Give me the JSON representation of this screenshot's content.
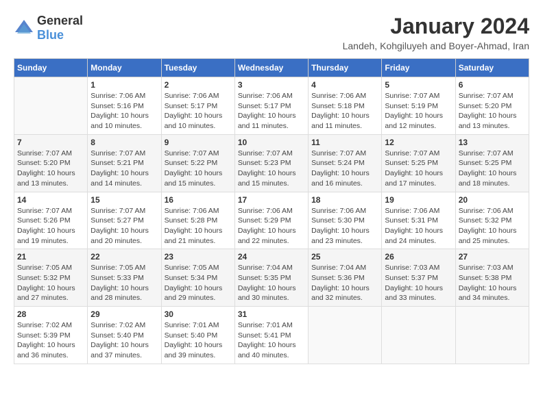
{
  "logo": {
    "text_general": "General",
    "text_blue": "Blue"
  },
  "header": {
    "month_year": "January 2024",
    "location": "Landeh, Kohgiluyeh and Boyer-Ahmad, Iran"
  },
  "weekdays": [
    "Sunday",
    "Monday",
    "Tuesday",
    "Wednesday",
    "Thursday",
    "Friday",
    "Saturday"
  ],
  "weeks": [
    [
      {
        "day": "",
        "info": ""
      },
      {
        "day": "1",
        "info": "Sunrise: 7:06 AM\nSunset: 5:16 PM\nDaylight: 10 hours and 10 minutes."
      },
      {
        "day": "2",
        "info": "Sunrise: 7:06 AM\nSunset: 5:17 PM\nDaylight: 10 hours and 10 minutes."
      },
      {
        "day": "3",
        "info": "Sunrise: 7:06 AM\nSunset: 5:17 PM\nDaylight: 10 hours and 11 minutes."
      },
      {
        "day": "4",
        "info": "Sunrise: 7:06 AM\nSunset: 5:18 PM\nDaylight: 10 hours and 11 minutes."
      },
      {
        "day": "5",
        "info": "Sunrise: 7:07 AM\nSunset: 5:19 PM\nDaylight: 10 hours and 12 minutes."
      },
      {
        "day": "6",
        "info": "Sunrise: 7:07 AM\nSunset: 5:20 PM\nDaylight: 10 hours and 13 minutes."
      }
    ],
    [
      {
        "day": "7",
        "info": "Sunrise: 7:07 AM\nSunset: 5:20 PM\nDaylight: 10 hours and 13 minutes."
      },
      {
        "day": "8",
        "info": "Sunrise: 7:07 AM\nSunset: 5:21 PM\nDaylight: 10 hours and 14 minutes."
      },
      {
        "day": "9",
        "info": "Sunrise: 7:07 AM\nSunset: 5:22 PM\nDaylight: 10 hours and 15 minutes."
      },
      {
        "day": "10",
        "info": "Sunrise: 7:07 AM\nSunset: 5:23 PM\nDaylight: 10 hours and 15 minutes."
      },
      {
        "day": "11",
        "info": "Sunrise: 7:07 AM\nSunset: 5:24 PM\nDaylight: 10 hours and 16 minutes."
      },
      {
        "day": "12",
        "info": "Sunrise: 7:07 AM\nSunset: 5:25 PM\nDaylight: 10 hours and 17 minutes."
      },
      {
        "day": "13",
        "info": "Sunrise: 7:07 AM\nSunset: 5:25 PM\nDaylight: 10 hours and 18 minutes."
      }
    ],
    [
      {
        "day": "14",
        "info": "Sunrise: 7:07 AM\nSunset: 5:26 PM\nDaylight: 10 hours and 19 minutes."
      },
      {
        "day": "15",
        "info": "Sunrise: 7:07 AM\nSunset: 5:27 PM\nDaylight: 10 hours and 20 minutes."
      },
      {
        "day": "16",
        "info": "Sunrise: 7:06 AM\nSunset: 5:28 PM\nDaylight: 10 hours and 21 minutes."
      },
      {
        "day": "17",
        "info": "Sunrise: 7:06 AM\nSunset: 5:29 PM\nDaylight: 10 hours and 22 minutes."
      },
      {
        "day": "18",
        "info": "Sunrise: 7:06 AM\nSunset: 5:30 PM\nDaylight: 10 hours and 23 minutes."
      },
      {
        "day": "19",
        "info": "Sunrise: 7:06 AM\nSunset: 5:31 PM\nDaylight: 10 hours and 24 minutes."
      },
      {
        "day": "20",
        "info": "Sunrise: 7:06 AM\nSunset: 5:32 PM\nDaylight: 10 hours and 25 minutes."
      }
    ],
    [
      {
        "day": "21",
        "info": "Sunrise: 7:05 AM\nSunset: 5:32 PM\nDaylight: 10 hours and 27 minutes."
      },
      {
        "day": "22",
        "info": "Sunrise: 7:05 AM\nSunset: 5:33 PM\nDaylight: 10 hours and 28 minutes."
      },
      {
        "day": "23",
        "info": "Sunrise: 7:05 AM\nSunset: 5:34 PM\nDaylight: 10 hours and 29 minutes."
      },
      {
        "day": "24",
        "info": "Sunrise: 7:04 AM\nSunset: 5:35 PM\nDaylight: 10 hours and 30 minutes."
      },
      {
        "day": "25",
        "info": "Sunrise: 7:04 AM\nSunset: 5:36 PM\nDaylight: 10 hours and 32 minutes."
      },
      {
        "day": "26",
        "info": "Sunrise: 7:03 AM\nSunset: 5:37 PM\nDaylight: 10 hours and 33 minutes."
      },
      {
        "day": "27",
        "info": "Sunrise: 7:03 AM\nSunset: 5:38 PM\nDaylight: 10 hours and 34 minutes."
      }
    ],
    [
      {
        "day": "28",
        "info": "Sunrise: 7:02 AM\nSunset: 5:39 PM\nDaylight: 10 hours and 36 minutes."
      },
      {
        "day": "29",
        "info": "Sunrise: 7:02 AM\nSunset: 5:40 PM\nDaylight: 10 hours and 37 minutes."
      },
      {
        "day": "30",
        "info": "Sunrise: 7:01 AM\nSunset: 5:40 PM\nDaylight: 10 hours and 39 minutes."
      },
      {
        "day": "31",
        "info": "Sunrise: 7:01 AM\nSunset: 5:41 PM\nDaylight: 10 hours and 40 minutes."
      },
      {
        "day": "",
        "info": ""
      },
      {
        "day": "",
        "info": ""
      },
      {
        "day": "",
        "info": ""
      }
    ]
  ]
}
